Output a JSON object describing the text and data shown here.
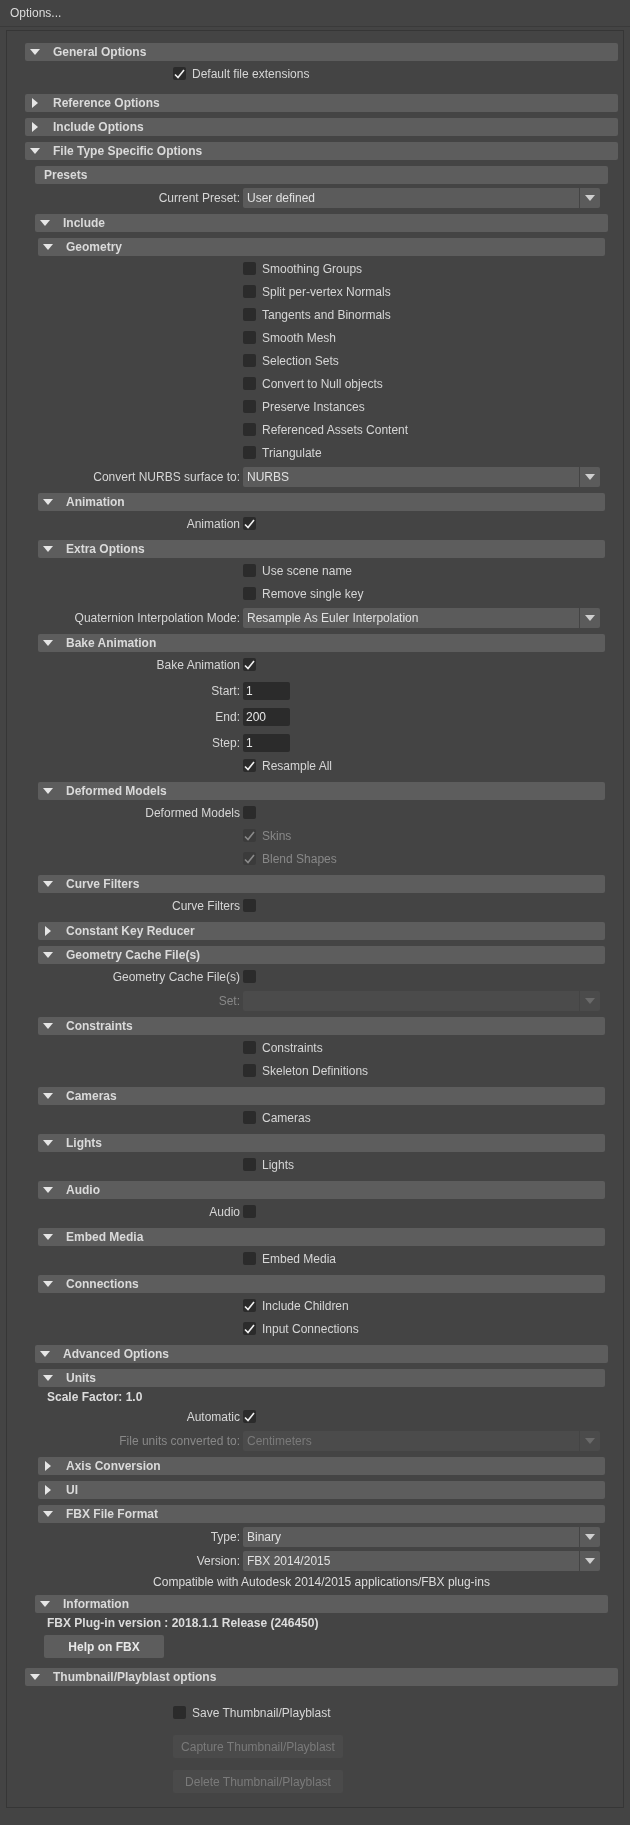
{
  "window": {
    "title": "Options..."
  },
  "sections": [
    {
      "kind": "section",
      "title": "General Options",
      "expanded": true,
      "children": [
        {
          "kind": "checkbox",
          "label": "Default file extensions",
          "checked": true,
          "disabled": false
        }
      ]
    },
    {
      "kind": "section",
      "title": "Reference Options",
      "expanded": false
    },
    {
      "kind": "section",
      "title": "Include Options",
      "expanded": false
    },
    {
      "kind": "section",
      "title": "File Type Specific Options",
      "expanded": true,
      "children": [
        {
          "kind": "heading",
          "title": "Presets",
          "children": [
            {
              "kind": "dropdown",
              "label": "Current Preset:",
              "value": "User defined",
              "disabled": false
            }
          ]
        },
        {
          "kind": "section",
          "title": "Include",
          "expanded": true,
          "children": [
            {
              "kind": "section",
              "title": "Geometry",
              "expanded": true,
              "children": [
                {
                  "kind": "checkbox",
                  "label": "Smoothing Groups",
                  "checked": false,
                  "disabled": false
                },
                {
                  "kind": "checkbox",
                  "label": "Split per-vertex Normals",
                  "checked": false,
                  "disabled": false
                },
                {
                  "kind": "checkbox",
                  "label": "Tangents and Binormals",
                  "checked": false,
                  "disabled": false
                },
                {
                  "kind": "checkbox",
                  "label": "Smooth Mesh",
                  "checked": false,
                  "disabled": false
                },
                {
                  "kind": "checkbox",
                  "label": "Selection Sets",
                  "checked": false,
                  "disabled": false
                },
                {
                  "kind": "checkbox",
                  "label": "Convert to Null objects",
                  "checked": false,
                  "disabled": false
                },
                {
                  "kind": "checkbox",
                  "label": "Preserve Instances",
                  "checked": false,
                  "disabled": false
                },
                {
                  "kind": "checkbox",
                  "label": "Referenced Assets Content",
                  "checked": false,
                  "disabled": false
                },
                {
                  "kind": "checkbox",
                  "label": "Triangulate",
                  "checked": false,
                  "disabled": false
                },
                {
                  "kind": "dropdown",
                  "label": "Convert NURBS surface to:",
                  "value": "NURBS",
                  "disabled": false
                }
              ]
            },
            {
              "kind": "section",
              "title": "Animation",
              "expanded": true,
              "children": [
                {
                  "kind": "toggle",
                  "label": "Animation",
                  "checked": true,
                  "disabled": false
                }
              ]
            },
            {
              "kind": "section",
              "title": "Extra Options",
              "expanded": true,
              "children": [
                {
                  "kind": "checkbox",
                  "label": "Use scene name",
                  "checked": false,
                  "disabled": false
                },
                {
                  "kind": "checkbox",
                  "label": "Remove single key",
                  "checked": false,
                  "disabled": false
                },
                {
                  "kind": "dropdown",
                  "label": "Quaternion Interpolation Mode:",
                  "value": "Resample As Euler Interpolation",
                  "disabled": false
                }
              ]
            },
            {
              "kind": "section",
              "title": "Bake Animation",
              "expanded": true,
              "children": [
                {
                  "kind": "toggle",
                  "label": "Bake Animation",
                  "checked": true,
                  "disabled": false
                },
                {
                  "kind": "field",
                  "label": "Start:",
                  "value": "1"
                },
                {
                  "kind": "field",
                  "label": "End:",
                  "value": "200"
                },
                {
                  "kind": "field",
                  "label": "Step:",
                  "value": "1"
                },
                {
                  "kind": "checkbox",
                  "label": "Resample All",
                  "checked": true,
                  "disabled": false
                }
              ]
            },
            {
              "kind": "section",
              "title": "Deformed Models",
              "expanded": true,
              "children": [
                {
                  "kind": "toggle",
                  "label": "Deformed Models",
                  "checked": false,
                  "disabled": false
                },
                {
                  "kind": "checkbox",
                  "label": "Skins",
                  "checked": true,
                  "disabled": true
                },
                {
                  "kind": "checkbox",
                  "label": "Blend Shapes",
                  "checked": true,
                  "disabled": true
                }
              ]
            },
            {
              "kind": "section",
              "title": "Curve Filters",
              "expanded": true,
              "children": [
                {
                  "kind": "toggle",
                  "label": "Curve Filters",
                  "checked": false,
                  "disabled": false
                }
              ]
            },
            {
              "kind": "section",
              "title": "Constant Key Reducer",
              "expanded": false
            },
            {
              "kind": "section",
              "title": "Geometry Cache File(s)",
              "expanded": true,
              "children": [
                {
                  "kind": "toggle",
                  "label": "Geometry Cache File(s)",
                  "checked": false,
                  "disabled": false
                },
                {
                  "kind": "dropdown",
                  "label": "Set:",
                  "disabled": true
                }
              ]
            },
            {
              "kind": "section",
              "title": "Constraints",
              "expanded": true,
              "children": [
                {
                  "kind": "checkbox",
                  "label": "Constraints",
                  "checked": false,
                  "disabled": false
                },
                {
                  "kind": "checkbox",
                  "label": "Skeleton Definitions",
                  "checked": false,
                  "disabled": false
                }
              ]
            },
            {
              "kind": "section",
              "title": "Cameras",
              "expanded": true,
              "children": [
                {
                  "kind": "checkbox",
                  "label": "Cameras",
                  "checked": false,
                  "disabled": false
                }
              ]
            },
            {
              "kind": "section",
              "title": "Lights",
              "expanded": true,
              "children": [
                {
                  "kind": "checkbox",
                  "label": "Lights",
                  "checked": false,
                  "disabled": false
                }
              ]
            },
            {
              "kind": "section",
              "title": "Audio",
              "expanded": true,
              "children": [
                {
                  "kind": "toggle",
                  "label": "Audio",
                  "checked": false,
                  "disabled": false
                }
              ]
            },
            {
              "kind": "section",
              "title": "Embed Media",
              "expanded": true,
              "children": [
                {
                  "kind": "checkbox",
                  "label": "Embed Media",
                  "checked": false,
                  "disabled": false
                }
              ]
            },
            {
              "kind": "section",
              "title": "Connections",
              "expanded": true,
              "children": [
                {
                  "kind": "checkbox",
                  "label": "Include Children",
                  "checked": true,
                  "disabled": false
                },
                {
                  "kind": "checkbox",
                  "label": "Input Connections",
                  "checked": true,
                  "disabled": false
                }
              ]
            }
          ]
        },
        {
          "kind": "section",
          "title": "Advanced Options",
          "expanded": true,
          "children": [
            {
              "kind": "section",
              "title": "Units",
              "expanded": true,
              "children": [
                {
                  "kind": "text",
                  "text": "Scale Factor: 1.0"
                },
                {
                  "kind": "toggle",
                  "label": "Automatic",
                  "checked": true,
                  "disabled": false
                },
                {
                  "kind": "dropdown",
                  "label": "File units converted to:",
                  "value": "Centimeters",
                  "disabled": true
                }
              ]
            },
            {
              "kind": "section",
              "title": "Axis Conversion",
              "expanded": false
            },
            {
              "kind": "section",
              "title": "UI",
              "expanded": false
            },
            {
              "kind": "section",
              "title": "FBX File Format",
              "expanded": true,
              "children": [
                {
                  "kind": "dropdown",
                  "label": "Type:",
                  "value": "Binary",
                  "disabled": false
                },
                {
                  "kind": "dropdown",
                  "label": "Version:",
                  "value": "FBX 2014/2015",
                  "disabled": false
                },
                {
                  "kind": "note",
                  "text": "Compatible with Autodesk 2014/2015 applications/FBX plug-ins"
                }
              ]
            }
          ]
        },
        {
          "kind": "section",
          "title": "Information",
          "expanded": true,
          "children": [
            {
              "kind": "text",
              "text": "FBX Plug-in version :  2018.1.1 Release (246450)"
            },
            {
              "kind": "button",
              "label": "Help on FBX",
              "disabled": false
            }
          ]
        }
      ]
    },
    {
      "kind": "section",
      "title": "Thumbnail/Playblast options",
      "expanded": true,
      "children": [
        {
          "kind": "checkbox",
          "label": "Save Thumbnail/Playblast",
          "checked": false,
          "disabled": false
        },
        {
          "kind": "button",
          "label": "Capture Thumbnail/Playblast",
          "disabled": true
        },
        {
          "kind": "button",
          "label": "Delete Thumbnail/Playblast",
          "disabled": true
        }
      ]
    }
  ]
}
